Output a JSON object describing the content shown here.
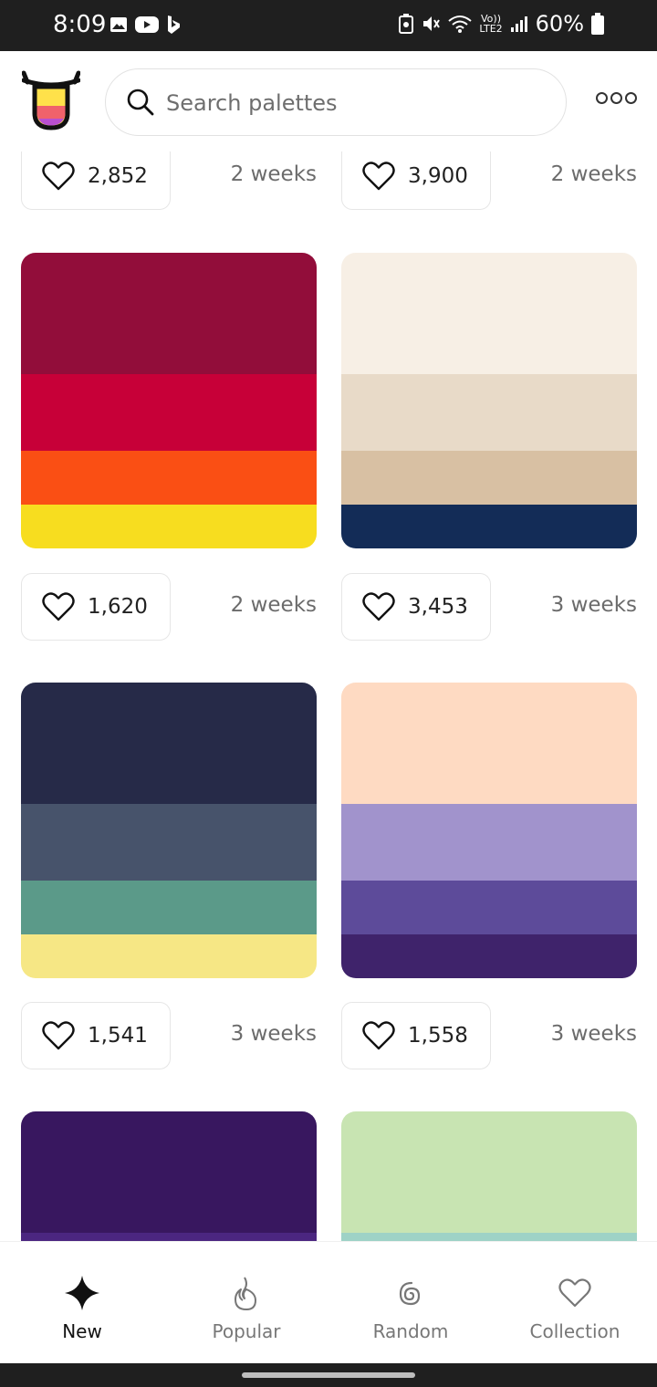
{
  "status_bar": {
    "time": "8:09",
    "network_top": "Vo))",
    "network_bottom": "LTE2",
    "battery": "60%"
  },
  "header": {
    "search_placeholder": "Search palettes"
  },
  "palettes": [
    {
      "likes": "2,852",
      "age": "2 weeks",
      "colors": []
    },
    {
      "likes": "3,900",
      "age": "2 weeks",
      "colors": []
    },
    {
      "likes": "1,620",
      "age": "2 weeks",
      "colors": [
        "#920D3A",
        "#C70038",
        "#FA4F14",
        "#F7DD1F"
      ]
    },
    {
      "likes": "3,453",
      "age": "3 weeks",
      "colors": [
        "#F7EFE5",
        "#E8DAC8",
        "#D8C0A3",
        "#132C57"
      ]
    },
    {
      "likes": "1,541",
      "age": "3 weeks",
      "colors": [
        "#262A48",
        "#47536B",
        "#5B9A89",
        "#F6E785"
      ]
    },
    {
      "likes": "1,558",
      "age": "3 weeks",
      "colors": [
        "#FEDAC2",
        "#A193CC",
        "#5D4B9A",
        "#3F236B"
      ]
    },
    {
      "colors": [
        "#38175F",
        "#4B2680"
      ]
    },
    {
      "colors": [
        "#C8E4B2",
        "#9ED2C6"
      ]
    }
  ],
  "nav": [
    {
      "label": "New",
      "icon": "sparkle-icon",
      "active": true
    },
    {
      "label": "Popular",
      "icon": "flame-icon",
      "active": false
    },
    {
      "label": "Random",
      "icon": "spiral-icon",
      "active": false
    },
    {
      "label": "Collection",
      "icon": "heart-icon",
      "active": false
    }
  ]
}
